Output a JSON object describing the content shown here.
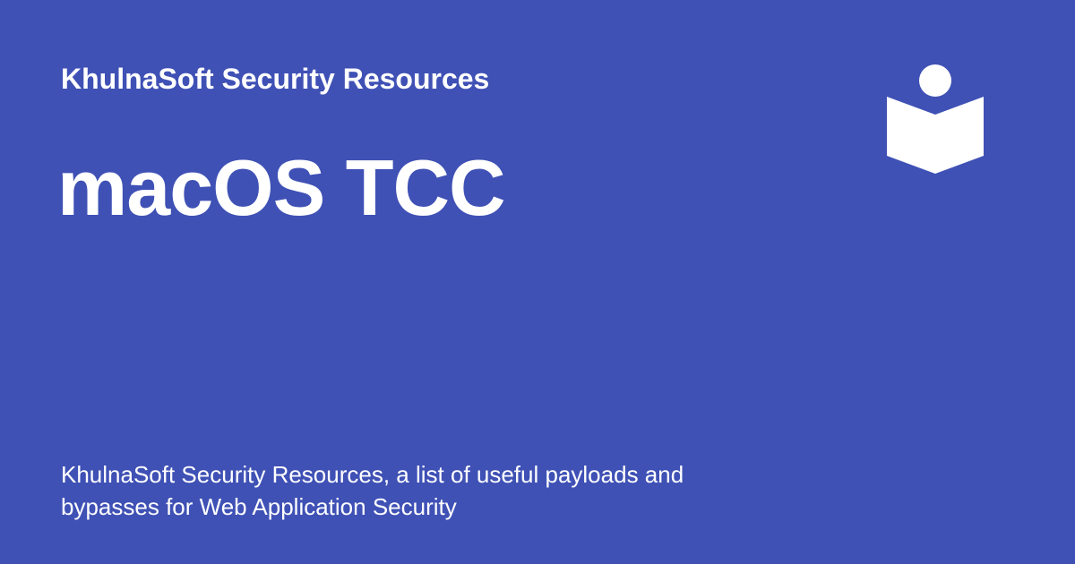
{
  "site": {
    "name": "KhulnaSoft Security Resources"
  },
  "page": {
    "title": "macOS TCC",
    "description": "KhulnaSoft Security Resources, a list of useful payloads and bypasses for Web Application Security"
  },
  "logo": {
    "icon": "book-reader-icon"
  },
  "colors": {
    "background": "#3f51b5",
    "foreground": "#ffffff"
  }
}
